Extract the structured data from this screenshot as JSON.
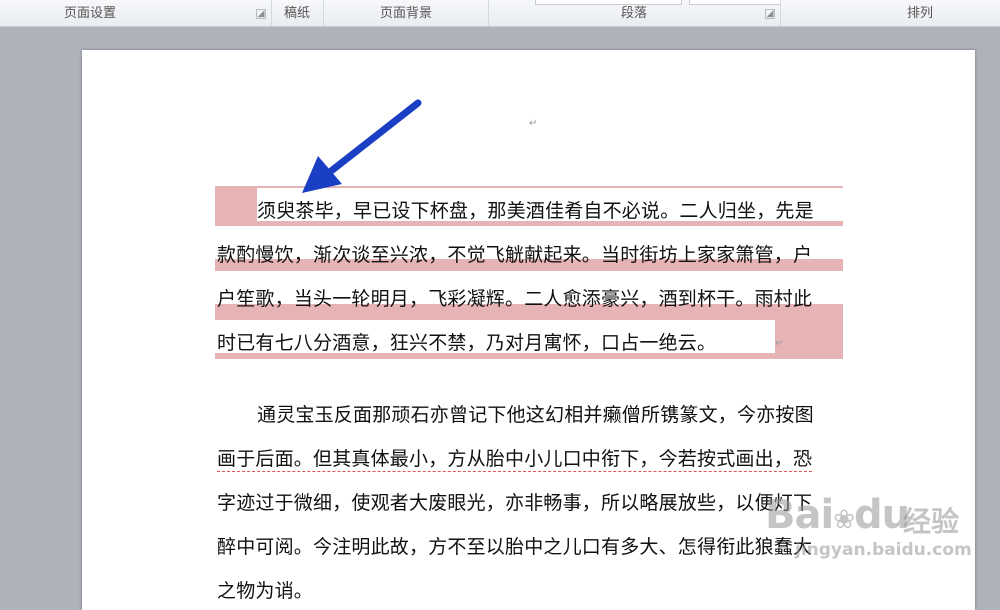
{
  "ribbon": {
    "groups": [
      {
        "label": "页面设置",
        "has_launcher": true
      },
      {
        "label": "稿纸",
        "has_launcher": false
      },
      {
        "label": "页面背景",
        "has_launcher": false
      },
      {
        "label": "段落",
        "has_launcher": true
      },
      {
        "label": "排列",
        "has_launcher": false
      }
    ]
  },
  "document": {
    "selected_paragraph": [
      "须臾茶毕，早已设下杯盘，那美酒佳肴自不必说。二人归坐，先是",
      "款酌慢饮，渐次谈至兴浓，不觉飞觥献起来。当时街坊上家家箫管，户",
      "户笙歌，当头一轮明月，飞彩凝辉。二人愈添豪兴，酒到杯干。雨村此",
      "时已有七八分酒意，狂兴不禁，乃对月寓怀，口占一绝云。"
    ],
    "second_paragraph": [
      "通灵宝玉反面那顽石亦曾记下他这幻相并癞僧所镌篆文，今亦按图",
      "画于后面。但其真体最小，方从胎中小儿口中衔下，今若按式画出，恐",
      "字迹过于微细，使观者大废眼光，亦非畅事，所以略展放些，以便灯下",
      "醉中可阅。今注明此故，方不至以胎中之儿口有多大、怎得衔此狼蠢大",
      "之物为诮。"
    ],
    "paragraph_mark": "↵"
  },
  "annotation": {
    "arrow_color": "#1a3fc4"
  },
  "watermark": {
    "brand": "Bai",
    "paw": "du",
    "cn": "经验",
    "url": "jingyan.baidu.com"
  }
}
